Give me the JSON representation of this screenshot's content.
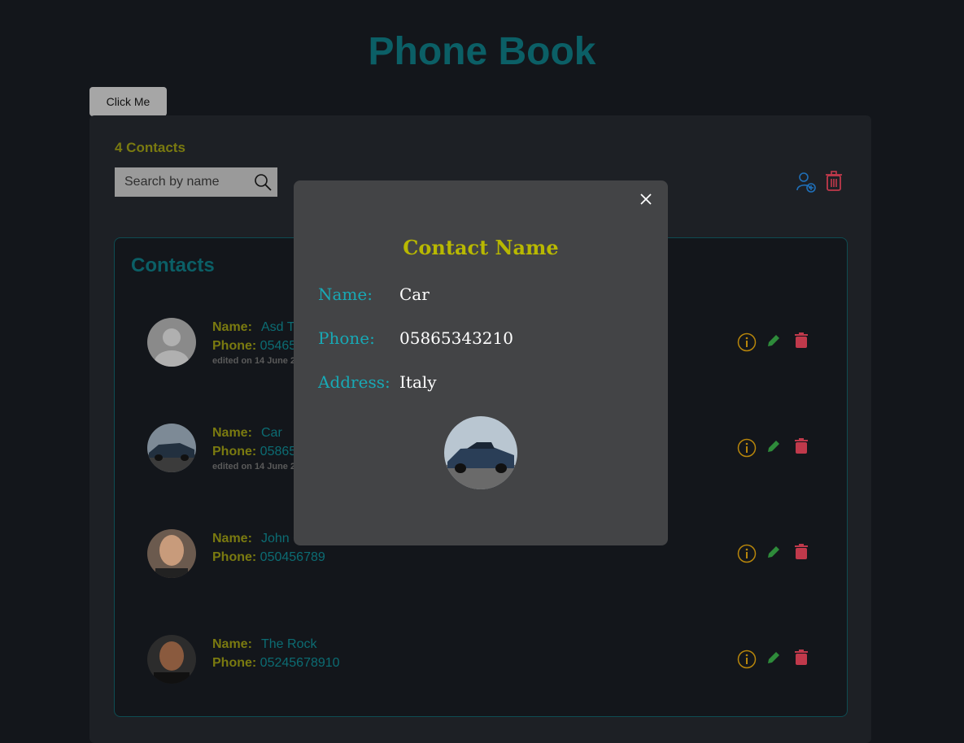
{
  "header": {
    "title": "Phone Book",
    "button_label": "Click Me"
  },
  "toolbar": {
    "count_label": "4 Contacts",
    "search_placeholder": "Search by name",
    "add_icon": "add-user-icon",
    "delete_all_icon": "trash-icon"
  },
  "contacts_section": {
    "heading": "Contacts",
    "name_label": "Name:",
    "phone_label": "Phone:",
    "rows": [
      {
        "name": "Asd T",
        "phone": "05465",
        "edited": "edited on 14 June 2",
        "avatar": "placeholder-avatar"
      },
      {
        "name": "Car",
        "phone": "05865",
        "edited": "edited on 14 June 2",
        "avatar": "car-photo"
      },
      {
        "name": "John C",
        "phone": "050456789",
        "edited": "",
        "avatar": "person-photo"
      },
      {
        "name": "The Rock",
        "phone": "05245678910",
        "edited": "",
        "avatar": "person-photo"
      }
    ]
  },
  "modal": {
    "title": "Contact Name",
    "close_label": "X",
    "name_label": "Name:",
    "name_value": "Car",
    "phone_label": "Phone:",
    "phone_value": "05865343210",
    "address_label": "Address:",
    "address_value": "Italy"
  },
  "colors": {
    "title": "#0b5f66",
    "label": "#7a7a10",
    "value": "#0c6c73",
    "info_icon": "#b8860b",
    "edit_icon": "#2e8b3a",
    "delete_icon": "#c0394b",
    "modal_title": "#b8b800",
    "modal_label": "#18a9b5"
  }
}
